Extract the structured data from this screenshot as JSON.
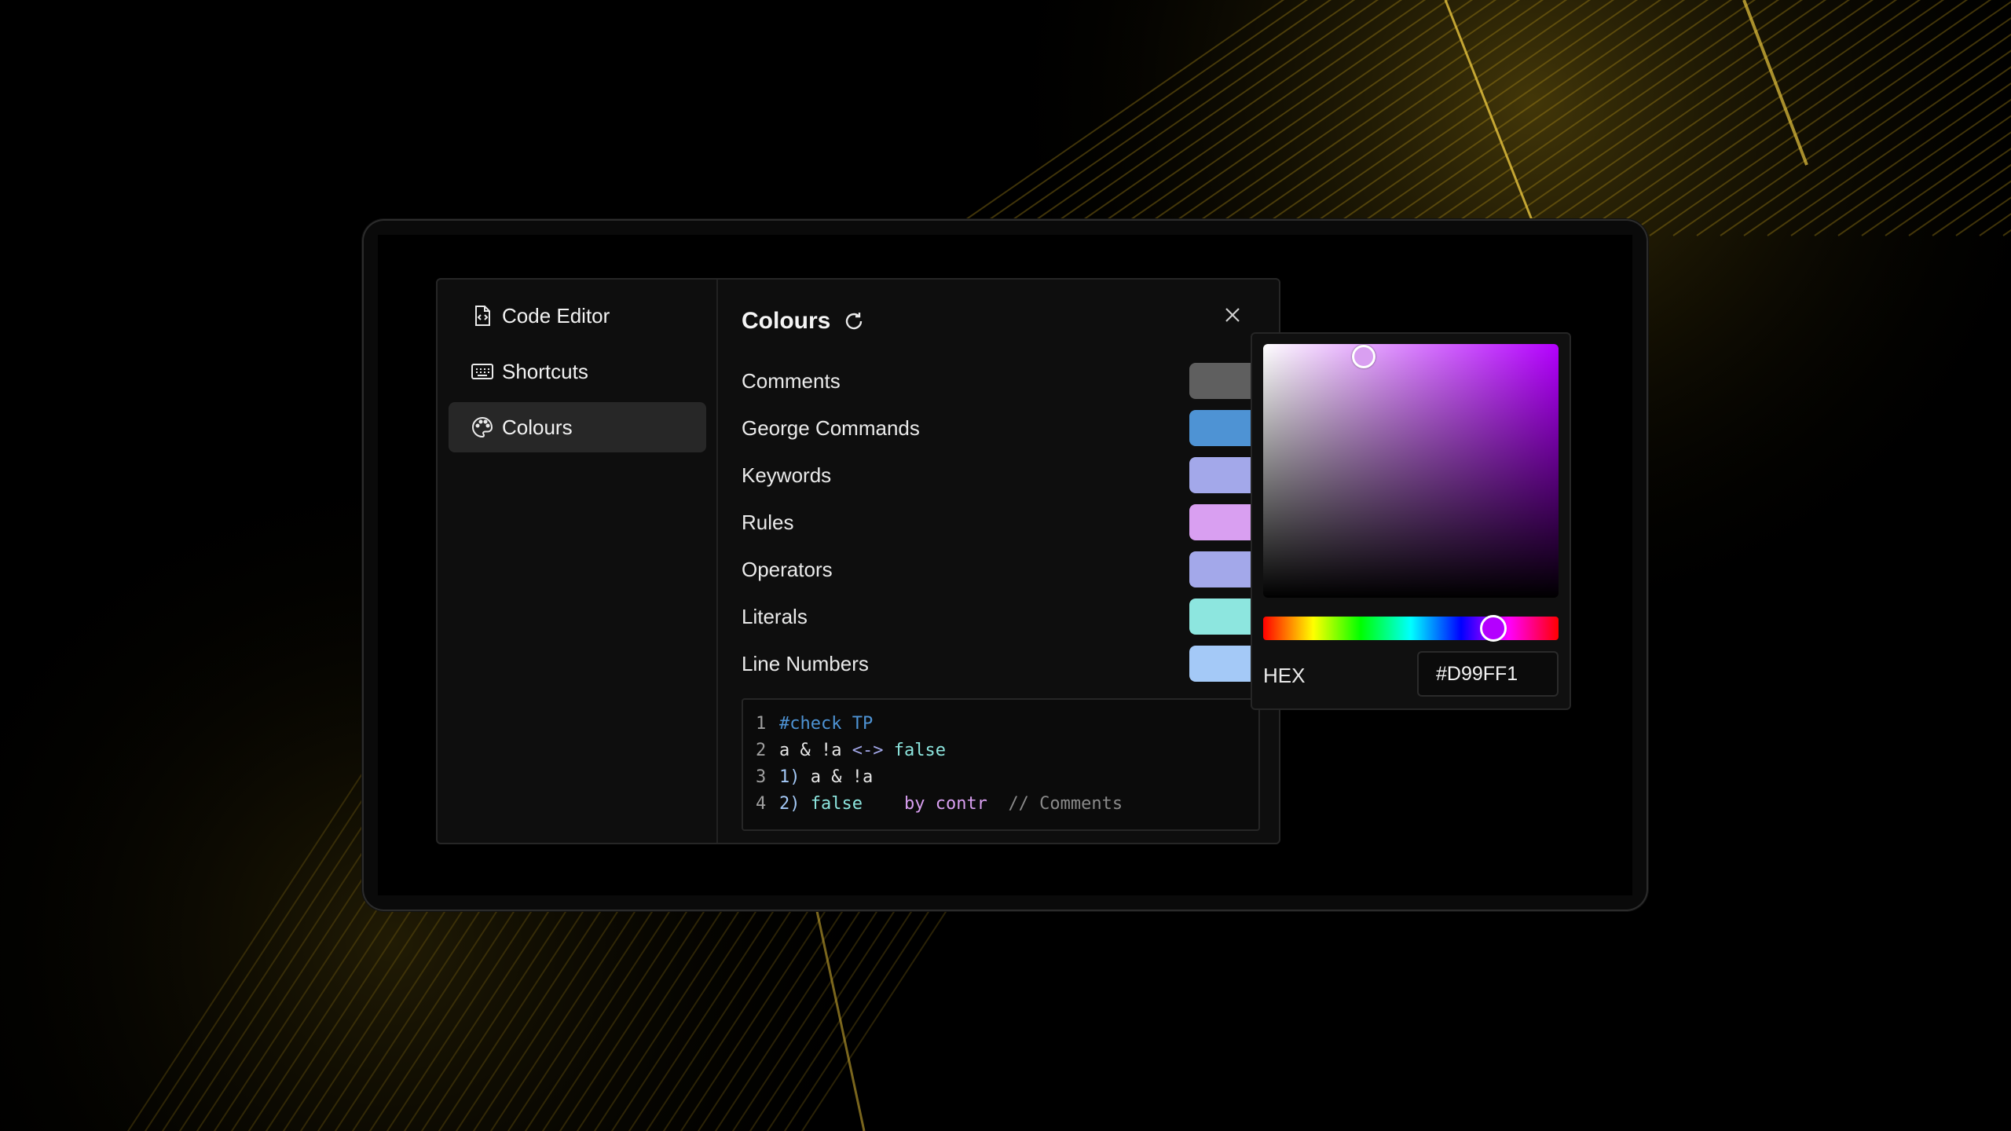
{
  "sidebar": {
    "items": [
      {
        "label": "Code Editor",
        "icon": "file-code-icon"
      },
      {
        "label": "Shortcuts",
        "icon": "keyboard-icon"
      },
      {
        "label": "Colours",
        "icon": "palette-icon",
        "active": true
      }
    ]
  },
  "panel": {
    "title": "Colours",
    "colors": [
      {
        "label": "Comments",
        "color": "#5f5f5f"
      },
      {
        "label": "George Commands",
        "color": "#4e93d4"
      },
      {
        "label": "Keywords",
        "color": "#a3a8ea"
      },
      {
        "label": "Rules",
        "color": "#d99ff1"
      },
      {
        "label": "Operators",
        "color": "#a3a8ea"
      },
      {
        "label": "Literals",
        "color": "#8de6df"
      },
      {
        "label": "Line Numbers",
        "color": "#a4c9f7"
      }
    ]
  },
  "code": {
    "lines": [
      {
        "n": "1",
        "tokens": [
          {
            "t": "#check TP",
            "c": "#4e93d4"
          }
        ]
      },
      {
        "n": "2",
        "tokens": [
          {
            "t": "a & !a ",
            "c": "#e6e6e6"
          },
          {
            "t": "<->",
            "c": "#a3a8ea"
          },
          {
            "t": " ",
            "c": "#e6e6e6"
          },
          {
            "t": "false",
            "c": "#8de6df"
          }
        ]
      },
      {
        "n": "3",
        "tokens": [
          {
            "t": "1)",
            "c": "#a4c9f7"
          },
          {
            "t": " a & !a",
            "c": "#e6e6e6"
          }
        ]
      },
      {
        "n": "4",
        "tokens": [
          {
            "t": "2)",
            "c": "#a4c9f7"
          },
          {
            "t": " ",
            "c": "#e6e6e6"
          },
          {
            "t": "false",
            "c": "#8de6df"
          },
          {
            "t": "    ",
            "c": "#e6e6e6"
          },
          {
            "t": "by contr",
            "c": "#d99ff1"
          },
          {
            "t": "  ",
            "c": "#e6e6e6"
          },
          {
            "t": "// Comments",
            "c": "#8a8a8a"
          }
        ]
      }
    ]
  },
  "picker": {
    "hex_label": "HEX",
    "hex_value": "#D99FF1",
    "saturation": 0.34,
    "value": 0.95,
    "hue_fraction": 0.78
  }
}
